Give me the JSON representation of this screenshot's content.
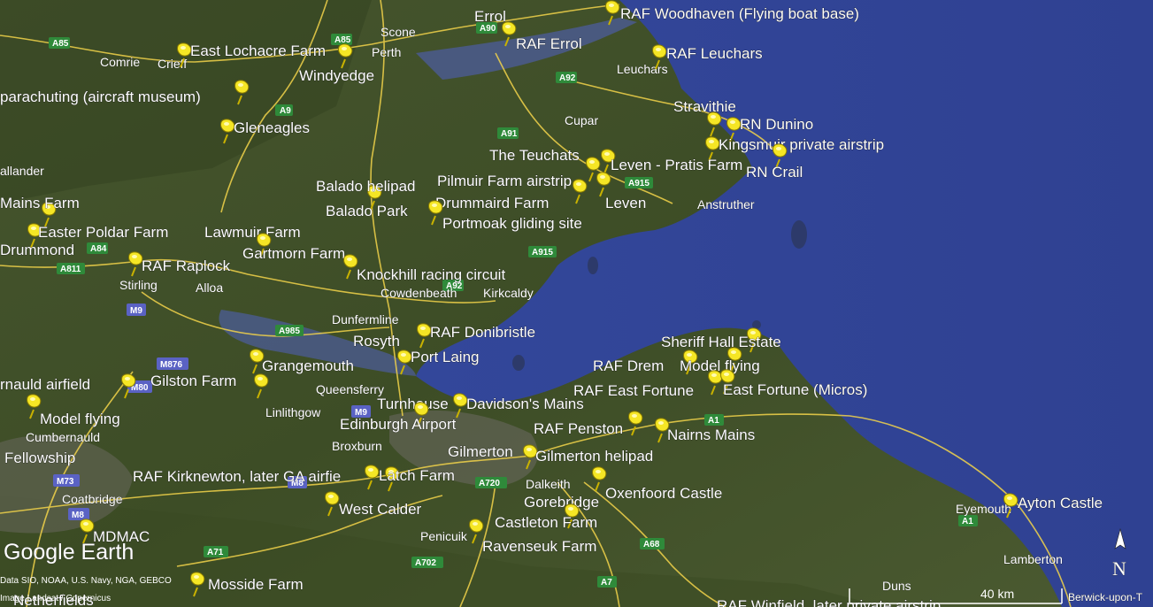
{
  "branding": {
    "logo": "Google Earth"
  },
  "attribution": {
    "line1": "Data SIO, NOAA, U.S. Navy, NGA, GEBCO",
    "line2": "Image Landsat / Copernicus"
  },
  "scale_bar": {
    "label": "40 km"
  },
  "compass": {
    "label": "N"
  },
  "colors": {
    "sea": "#3a4f9c",
    "land": "#3e4f27",
    "road": "#f2d34a",
    "motorway_badge": "#5a62c4",
    "a_road_badge": "#2f8a3a",
    "pin": "#f5e625"
  },
  "placemarks": [
    {
      "label": "RAF Woodhaven (Flying boat base)"
    },
    {
      "label": "RAF Errol"
    },
    {
      "label": "Errol"
    },
    {
      "label": "RAF Leuchars"
    },
    {
      "label": "East Lochacre Farm"
    },
    {
      "label": "Windyedge"
    },
    {
      "label": "parachuting (aircraft museum)"
    },
    {
      "label": "Gleneagles"
    },
    {
      "label": "Stravithie"
    },
    {
      "label": "RN Dunino"
    },
    {
      "label": "Kingsmuir private airstrip"
    },
    {
      "label": "The Teuchats"
    },
    {
      "label": "Leven - Pratis Farm"
    },
    {
      "label": "RN Crail"
    },
    {
      "label": "Balado helipad"
    },
    {
      "label": "Pilmuir Farm airstrip"
    },
    {
      "label": "Balado Park"
    },
    {
      "label": "Drummaird Farm"
    },
    {
      "label": "Leven"
    },
    {
      "label": "Mains Farm"
    },
    {
      "label": "Portmoak gliding site"
    },
    {
      "label": "Easter Poldar Farm"
    },
    {
      "label": "Lawmuir Farm"
    },
    {
      "label": "Drummond"
    },
    {
      "label": "Gartmorn Farm"
    },
    {
      "label": "RAF Raplock"
    },
    {
      "label": "Knockhill racing circuit"
    },
    {
      "label": "RAF Donibristle"
    },
    {
      "label": "Rosyth"
    },
    {
      "label": "Sheriff Hall Estate"
    },
    {
      "label": "Port Laing"
    },
    {
      "label": "Grangemouth"
    },
    {
      "label": "RAF Drem"
    },
    {
      "label": "Model flying"
    },
    {
      "label": "RAF East Fortune"
    },
    {
      "label": "East Fortune (Micros)"
    },
    {
      "label": "rnauld airfield"
    },
    {
      "label": "Gilston Farm"
    },
    {
      "label": "Turnhouse"
    },
    {
      "label": "Davidson's Mains"
    },
    {
      "label": "Model flying"
    },
    {
      "label": "Edinburgh Airport"
    },
    {
      "label": "RAF Penston"
    },
    {
      "label": "Nairns Mains"
    },
    {
      "label": "Fellowship"
    },
    {
      "label": "Gilmerton"
    },
    {
      "label": "Gilmerton helipad"
    },
    {
      "label": "RAF Kirknewton, later GA airfie"
    },
    {
      "label": "Latch Farm"
    },
    {
      "label": "Oxenfoord Castle"
    },
    {
      "label": "West Calder"
    },
    {
      "label": "Gorebridge"
    },
    {
      "label": "Ayton Castle"
    },
    {
      "label": "Castleton Farm"
    },
    {
      "label": "MDMAC"
    },
    {
      "label": "Ravenseuk Farm"
    },
    {
      "label": "Mosside Farm"
    },
    {
      "label": "Netherfields"
    },
    {
      "label": "RAF Winfield, later private airstrip"
    }
  ],
  "towns": [
    {
      "name": "Scone"
    },
    {
      "name": "Perth"
    },
    {
      "name": "Comrie"
    },
    {
      "name": "Crieff"
    },
    {
      "name": "Leuchars"
    },
    {
      "name": "Cupar"
    },
    {
      "name": "Anstruther"
    },
    {
      "name": "allander"
    },
    {
      "name": "Stirling"
    },
    {
      "name": "Alloa"
    },
    {
      "name": "Cowdenbeath"
    },
    {
      "name": "Kirkcaldy"
    },
    {
      "name": "Dunfermline"
    },
    {
      "name": "Queensferry"
    },
    {
      "name": "Linlithgow"
    },
    {
      "name": "Cumbernauld"
    },
    {
      "name": "Broxburn"
    },
    {
      "name": "Coatbridge"
    },
    {
      "name": "Dalkeith"
    },
    {
      "name": "Penicuik"
    },
    {
      "name": "Eyemouth"
    },
    {
      "name": "Lamberton"
    },
    {
      "name": "Duns"
    },
    {
      "name": "Berwick-upon-T"
    }
  ],
  "roads": [
    {
      "ref": "A85"
    },
    {
      "ref": "A85"
    },
    {
      "ref": "A90"
    },
    {
      "ref": "A92"
    },
    {
      "ref": "A9"
    },
    {
      "ref": "A91"
    },
    {
      "ref": "A915"
    },
    {
      "ref": "A915"
    },
    {
      "ref": "A811"
    },
    {
      "ref": "A84"
    },
    {
      "ref": "A92"
    },
    {
      "ref": "M9"
    },
    {
      "ref": "A985"
    },
    {
      "ref": "M876"
    },
    {
      "ref": "M80"
    },
    {
      "ref": "M9"
    },
    {
      "ref": "M73"
    },
    {
      "ref": "M8"
    },
    {
      "ref": "A720"
    },
    {
      "ref": "A71"
    },
    {
      "ref": "A702"
    },
    {
      "ref": "A68"
    },
    {
      "ref": "A7"
    },
    {
      "ref": "A1"
    },
    {
      "ref": "A1"
    },
    {
      "ref": "M8"
    }
  ]
}
